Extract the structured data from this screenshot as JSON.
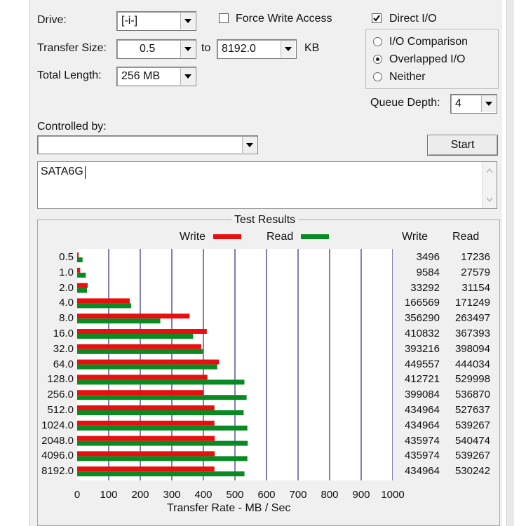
{
  "colors": {
    "write": "#e80f0f",
    "read": "#0a8a22",
    "grid": "#3a3a8a"
  },
  "controls": {
    "drive_label": "Drive:",
    "drive_value": "[-i-]",
    "force_write_label": "Force Write Access",
    "direct_io_label": "Direct I/O",
    "direct_io_checked": true,
    "transfer_size_label": "Transfer Size:",
    "transfer_from": "0.5",
    "to_label": "to",
    "transfer_to": "8192.0",
    "kb_label": "KB",
    "total_length_label": "Total Length:",
    "total_length_value": "256 MB",
    "io_comparison_label": "I/O Comparison",
    "overlapped_io_label": "Overlapped I/O",
    "neither_label": "Neither",
    "queue_depth_label": "Queue Depth:",
    "queue_depth_value": "4",
    "controlled_by_label": "Controlled by:",
    "controlled_by_value": "",
    "start_label": "Start",
    "description_text": "SATA6G"
  },
  "results": {
    "title": "Test Results",
    "write_header": "Write",
    "read_header": "Read"
  },
  "chart_data": {
    "type": "bar",
    "orientation": "horizontal",
    "xlabel": "Transfer Rate - MB / Sec",
    "xlim": [
      0,
      1000
    ],
    "xticks": [
      "0",
      "100",
      "200",
      "300",
      "400",
      "500",
      "600",
      "700",
      "800",
      "900",
      "1000"
    ],
    "grid": true,
    "legend_placement": "top",
    "categories": [
      "0.5",
      "1.0",
      "2.0",
      "4.0",
      "8.0",
      "16.0",
      "32.0",
      "64.0",
      "128.0",
      "256.0",
      "512.0",
      "1024.0",
      "2048.0",
      "4096.0",
      "8192.0"
    ],
    "series": [
      {
        "name": "Write",
        "values": [
          3.5,
          9.6,
          33.3,
          166.6,
          356.3,
          410.8,
          393.2,
          449.6,
          412.7,
          399.1,
          435.0,
          435.0,
          436.0,
          436.0,
          435.0
        ]
      },
      {
        "name": "Read",
        "values": [
          17.2,
          27.6,
          31.2,
          171.2,
          263.5,
          367.4,
          398.1,
          444.0,
          530.0,
          536.9,
          527.6,
          539.3,
          540.5,
          539.3,
          530.2
        ]
      }
    ],
    "write_values": [
      "3496",
      "9584",
      "33292",
      "166569",
      "356290",
      "410832",
      "393216",
      "449557",
      "412721",
      "399084",
      "434964",
      "434964",
      "435974",
      "435974",
      "434964"
    ],
    "read_values": [
      "17236",
      "27579",
      "31154",
      "171249",
      "263497",
      "367393",
      "398094",
      "444034",
      "529998",
      "536870",
      "527637",
      "539267",
      "540474",
      "539267",
      "530242"
    ]
  }
}
